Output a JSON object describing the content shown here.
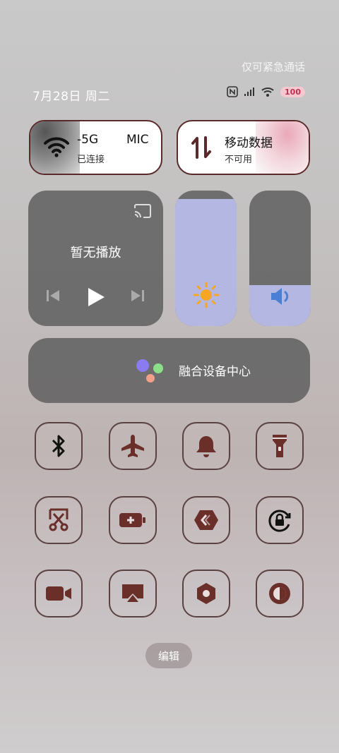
{
  "status_bar": {
    "emergency_text": "仅可紧急通话",
    "date_text": "7月28日 周二",
    "battery_level": "100"
  },
  "wifi_tile": {
    "network_name": "-5G",
    "network_suffix": "MIC",
    "status": "已连接"
  },
  "data_tile": {
    "label": "移动数据",
    "status": "不可用"
  },
  "media": {
    "title": "暂无播放"
  },
  "brightness": {
    "level_percent": 94
  },
  "volume": {
    "level_percent": 30
  },
  "fusion": {
    "label": "融合设备中心"
  },
  "toggles": [
    {
      "icon": "bluetooth-icon"
    },
    {
      "icon": "airplane-icon"
    },
    {
      "icon": "bell-icon"
    },
    {
      "icon": "flashlight-icon"
    },
    {
      "icon": "screenshot-icon"
    },
    {
      "icon": "battery-saver-icon"
    },
    {
      "icon": "share-icon"
    },
    {
      "icon": "rotation-lock-icon"
    },
    {
      "icon": "screen-record-icon"
    },
    {
      "icon": "screen-cast-icon"
    },
    {
      "icon": "settings-icon"
    },
    {
      "icon": "dark-mode-icon"
    }
  ],
  "edit_label": "编辑",
  "colors": {
    "accent": "#b5b7e3",
    "icon": "#6b2f2a",
    "sun": "#f5a623",
    "speaker": "#4a7fd6"
  }
}
